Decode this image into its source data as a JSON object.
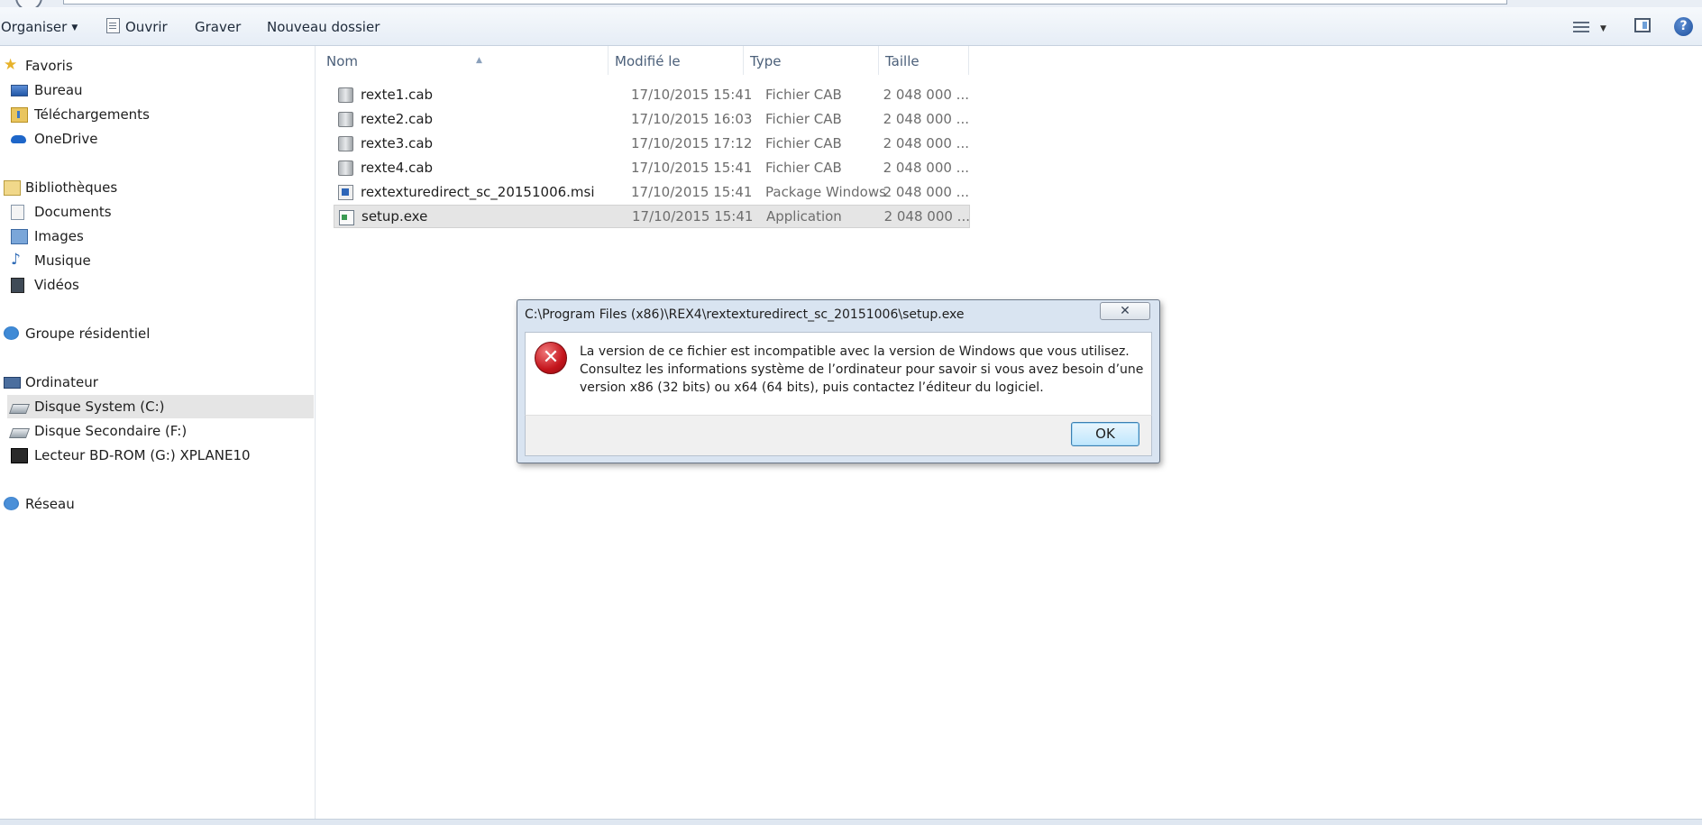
{
  "toolbar": {
    "organiser": "Organiser",
    "ouvrir": "Ouvrir",
    "graver": "Graver",
    "nouveau_dossier": "Nouveau dossier",
    "help": "?"
  },
  "nav": {
    "favoris": "Favoris",
    "bureau": "Bureau",
    "telechargements": "Téléchargements",
    "onedrive": "OneDrive",
    "bibliotheques": "Bibliothèques",
    "documents": "Documents",
    "images": "Images",
    "musique": "Musique",
    "videos": "Vidéos",
    "groupe_residentiel": "Groupe résidentiel",
    "ordinateur": "Ordinateur",
    "disque_system": "Disque System (C:)",
    "disque_secondaire": "Disque Secondaire (F:)",
    "lecteur_bd": "Lecteur BD-ROM (G:) XPLANE10",
    "reseau": "Réseau"
  },
  "columns": {
    "nom": "Nom",
    "modifie": "Modifié le",
    "type": "Type",
    "taille": "Taille"
  },
  "files": [
    {
      "name": "rexte1.cab",
      "date": "17/10/2015 15:41",
      "type": "Fichier CAB",
      "size": "2 048 000 ...",
      "icon": "cab-file-icon"
    },
    {
      "name": "rexte2.cab",
      "date": "17/10/2015 16:03",
      "type": "Fichier CAB",
      "size": "2 048 000 ...",
      "icon": "cab-file-icon"
    },
    {
      "name": "rexte3.cab",
      "date": "17/10/2015 17:12",
      "type": "Fichier CAB",
      "size": "2 048 000 ...",
      "icon": "cab-file-icon"
    },
    {
      "name": "rexte4.cab",
      "date": "17/10/2015 15:41",
      "type": "Fichier CAB",
      "size": "2 048 000 ...",
      "icon": "cab-file-icon"
    },
    {
      "name": "rextexturedirect_sc_20151006.msi",
      "date": "17/10/2015 15:41",
      "type": "Package Windows ...",
      "size": "2 048 000 ...",
      "icon": "msi-file-icon"
    },
    {
      "name": "setup.exe",
      "date": "17/10/2015 15:41",
      "type": "Application",
      "size": "2 048 000 ...",
      "icon": "exe-file-icon"
    }
  ],
  "dialog": {
    "title": "C:\\Program Files (x86)\\REX4\\rextexturedirect_sc_20151006\\setup.exe",
    "message_line1": "La version de ce fichier est incompatible avec la version de Windows que vous utilisez.",
    "message_line2": "Consultez les informations système de l’ordinateur pour savoir si vous avez besoin d’une",
    "message_line3": "version x86 (32 bits) ou x64 (64 bits), puis contactez l’éditeur du logiciel.",
    "ok": "OK",
    "close": "✕"
  },
  "colors": {
    "selection": "#e5e5e5",
    "error_red": "#c4151c",
    "ok_button": "#bee6fd"
  }
}
